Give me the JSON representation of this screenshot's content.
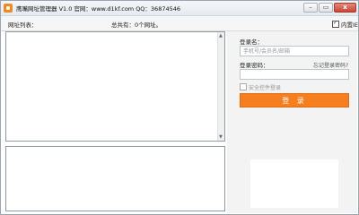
{
  "titlebar": {
    "title": "鹰嘴网址管理器 V1.0   官网：www.d1kf.com   QQ：36874546",
    "min_symbol": "–",
    "max_symbol": "▭",
    "close_symbol": "x"
  },
  "toolbar": {
    "url_list_label": "网址列表：",
    "total_label": "总共有：0个网址。",
    "embed_label": "内置IE",
    "embed_checked": true
  },
  "login": {
    "username_label": "登录名：",
    "username_placeholder": "手机号/会员名/邮箱",
    "password_label": "登录密码：",
    "forgot_link": "忘记登录密码?",
    "safe_control_label": "安全控件登录",
    "login_button": "登  录"
  },
  "scrollbar": {
    "up_symbol": "▲",
    "down_symbol": "▼"
  }
}
